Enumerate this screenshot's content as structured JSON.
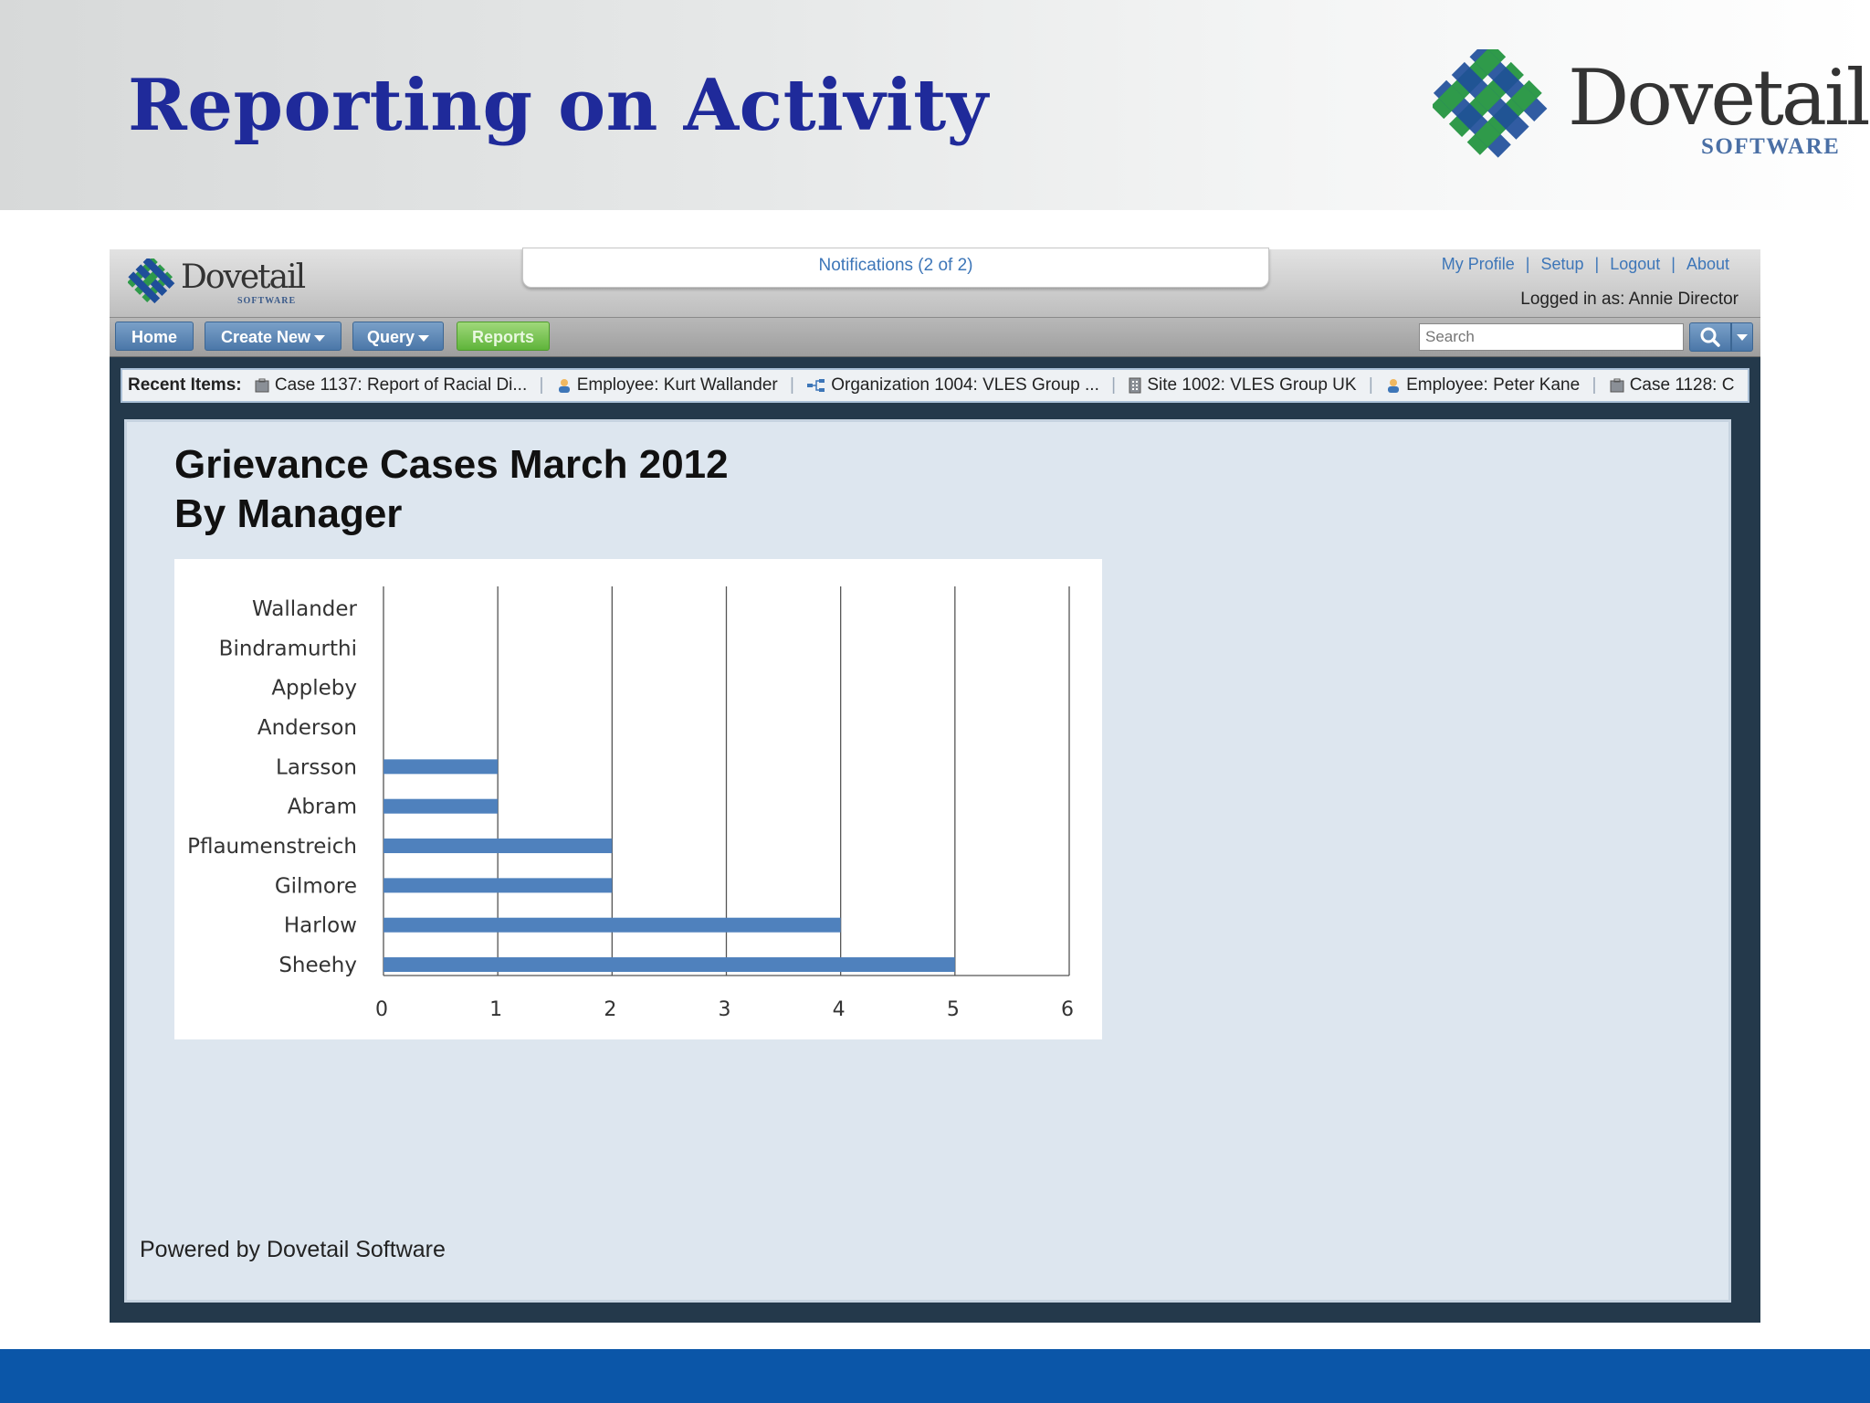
{
  "slide": {
    "title": "Reporting on Activity",
    "brand_name": "Dovetail",
    "brand_sub": "SOFTWARE",
    "colors": {
      "title": "#1f2a9a",
      "bottom_bar": "#0b56a8"
    }
  },
  "app": {
    "logo_name": "Dovetail",
    "logo_sub": "SOFTWARE",
    "notifications": "Notifications (2 of 2)",
    "top_links": [
      "My Profile",
      "Setup",
      "Logout",
      "About"
    ],
    "logged_in": "Logged in as: Annie Director",
    "nav": {
      "home": "Home",
      "create_new": "Create New",
      "query": "Query",
      "reports": "Reports"
    },
    "search": {
      "placeholder": "Search",
      "icon": "magnifier-icon"
    },
    "recent": {
      "label": "Recent Items:",
      "items": [
        {
          "icon": "case-icon",
          "text": "Case 1137: Report of Racial Di..."
        },
        {
          "icon": "employee-icon",
          "text": "Employee: Kurt Wallander"
        },
        {
          "icon": "organization-icon",
          "text": "Organization 1004: VLES Group ..."
        },
        {
          "icon": "site-icon",
          "text": "Site 1002: VLES Group UK"
        },
        {
          "icon": "employee-icon",
          "text": "Employee: Peter Kane"
        },
        {
          "icon": "case-icon",
          "text": "Case 1128: C"
        }
      ]
    },
    "report": {
      "title_line1": "Grievance Cases March 2012",
      "title_line2": "By Manager"
    },
    "powered_by": "Powered by Dovetail Software"
  },
  "chart_data": {
    "type": "bar",
    "orientation": "horizontal",
    "categories": [
      "Wallander",
      "Bindramurthi",
      "Appleby",
      "Anderson",
      "Larsson",
      "Abram",
      "Pflaumenstreich",
      "Gilmore",
      "Harlow",
      "Sheehy"
    ],
    "values": [
      0,
      0,
      0,
      0,
      1,
      1,
      2,
      2,
      4,
      5
    ],
    "xlim": [
      0,
      6
    ],
    "xticks": [
      0,
      1,
      2,
      3,
      4,
      5,
      6
    ],
    "grid": "vertical",
    "bar_color": "#4f81bd"
  }
}
